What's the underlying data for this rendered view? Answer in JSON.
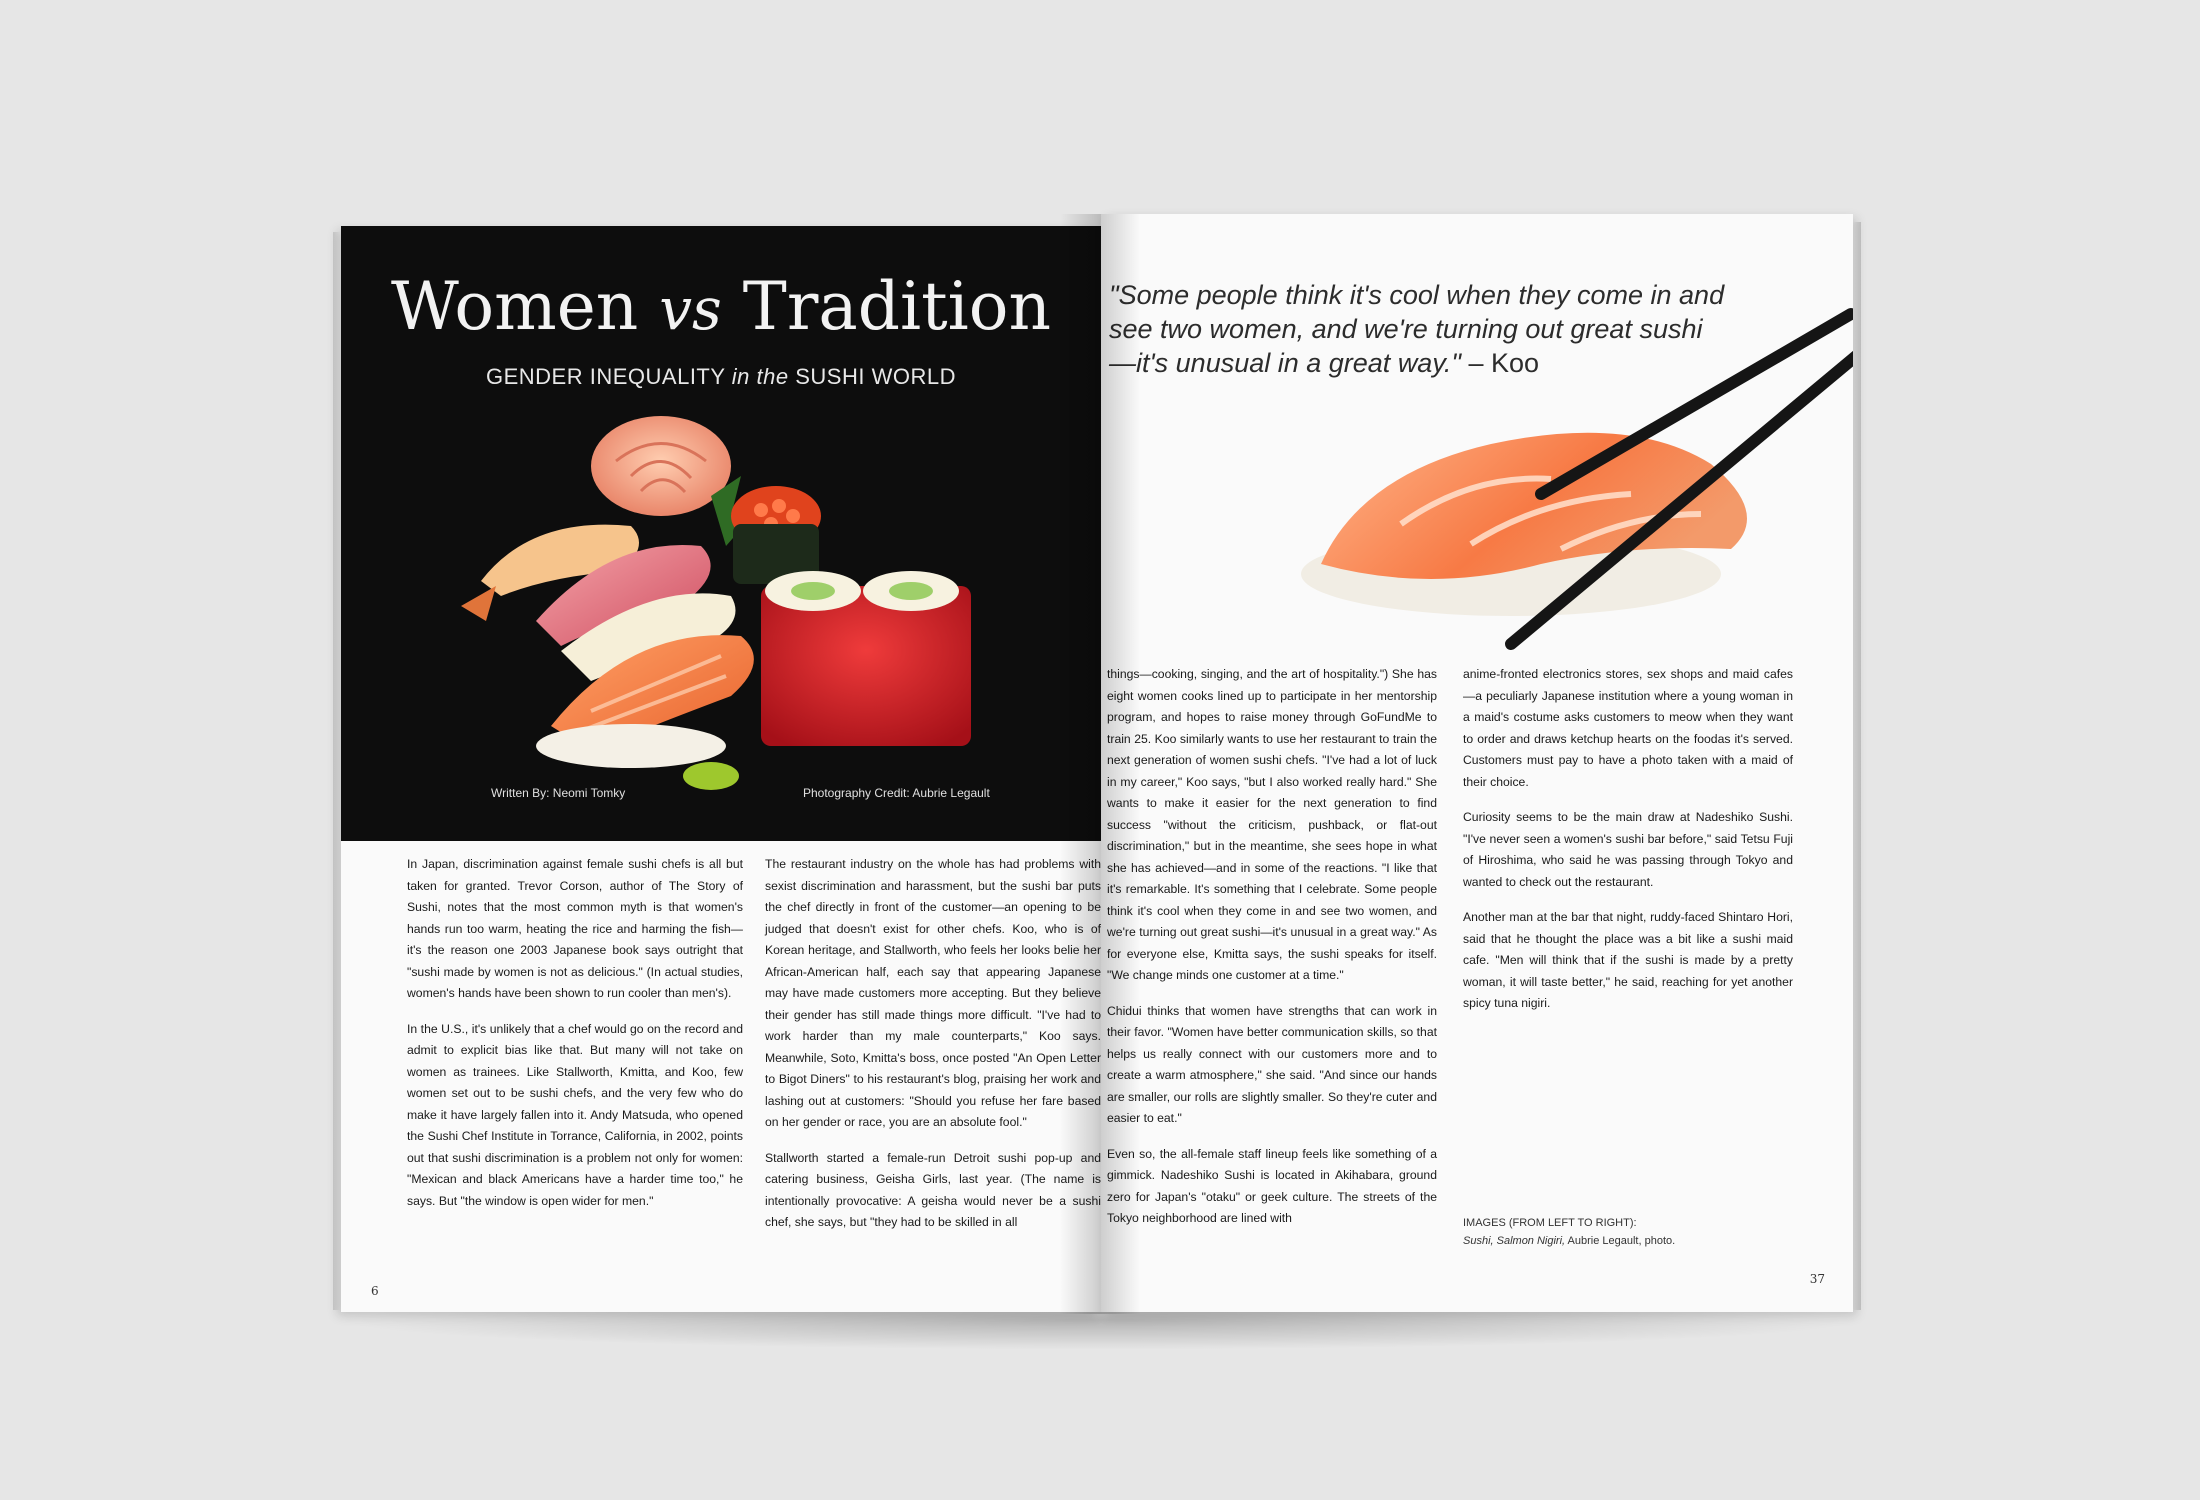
{
  "left_page": {
    "title_main": "Women",
    "title_vs": "vs",
    "title_end": "Tradition",
    "subtitle_a": "GENDER INEQUALITY",
    "subtitle_b": "in the",
    "subtitle_c": "SUSHI WORLD",
    "credit_writer": "Written By: Neomi Tomky",
    "credit_photo": "Photography Credit: Aubrie Legault",
    "col1": [
      "In Japan, discrimination against female sushi chefs is all but taken for granted. Trevor Corson, author of The Story of Sushi, notes that the most common myth is that women's hands run too warm, heating the rice and harming the fish—it's the reason one 2003 Japanese book says outright that \"sushi made by women is not as delicious.\" (In actual studies, women's hands have been shown to run cooler than men's).",
      "In the U.S., it's unlikely that a chef would go on the record and admit to explicit bias like that. But many will not take on women as trainees. Like Stallworth, Kmitta, and Koo, few women set out to be sushi chefs, and the very few who do make it have largely fallen into it. Andy Matsuda, who opened the Sushi Chef Institute in Torrance, California, in 2002, points out that sushi discrimination is a problem not only for women: \"Mexican and black Americans have a harder time too,\" he says. But \"the window is open wider for men.\""
    ],
    "col2": [
      "The restaurant industry on the whole has had problems with sexist discrimination and harassment, but the sushi bar puts the chef directly in front of the customer—an opening to be judged that doesn't exist for other chefs. Koo, who is of Korean heritage, and Stallworth, who feels her looks belie her African-American half, each say that appearing Japanese may have made customers more accepting. But they believe their gender has still made things more difficult. \"I've had to work harder than my male counterparts,\" Koo says. Meanwhile, Soto, Kmitta's boss, once posted \"An Open Letter to Bigot Diners\" to his restaurant's blog, praising her work and lashing out at customers: \"Should you refuse her fare based on her gender or race, you are an absolute fool.\"",
      "Stallworth started a female-run Detroit sushi pop-up and catering business, Geisha Girls, last year. (The name is intentionally provocative: A geisha would never be a sushi chef, she says, but \"they had to be skilled in all"
    ],
    "page_number": "6"
  },
  "right_page": {
    "quote": "\"Some people think it's cool when they come in and see two women, and we're turning out great sushi—it's unusual in a great way.\"",
    "quote_attr": "– Koo",
    "col1": [
      "things—cooking, singing, and the art of hospitality.\") She has eight women cooks lined up to participate in her mentorship program, and hopes to raise money through GoFundMe to train 25. Koo similarly wants to use her restaurant to train the next generation of women sushi chefs. \"I've had a lot of luck in my career,\" Koo says, \"but I also worked really hard.\" She wants to make it easier for the next generation to find success \"without the criticism, pushback, or flat-out discrimination,\" but in the meantime, she sees hope in what she has achieved—and in some of the reactions. \"I like that it's remarkable. It's something that I celebrate. Some people think it's cool when they come in and see two women, and we're turning out great sushi—it's unusual in a great way.\" As for everyone else, Kmitta says, the sushi speaks for itself. \"We change minds one customer at a time.\"",
      "Chidui thinks that women have strengths that can work in their favor. \"Women have better communication skills, so that helps us really connect with our customers more and to create a warm atmosphere,\" she said. \"And since our hands are smaller, our rolls are slightly smaller. So they're cuter and easier to eat.\"",
      "Even so, the all-female staff lineup feels like something of a gimmick. Nadeshiko Sushi is located in Akihabara, ground zero for Japan's \"otaku\" or geek culture. The streets of the Tokyo neighborhood are lined with"
    ],
    "col2": [
      "anime-fronted electronics stores, sex shops and maid cafes—a peculiarly Japanese institution where a young woman in a maid's costume asks customers to meow when they want to order and draws ketchup hearts on the foodas it's served. Customers must pay to have a photo taken with a maid of their choice.",
      "Curiosity seems to be the main draw at Nadeshiko Sushi. \"I've never seen a women's sushi bar before,\" said Tetsu Fuji of Hiroshima, who said he was passing through Tokyo and wanted to check out the restaurant.",
      "Another man at the bar that night, ruddy-faced Shintaro Hori, said that he thought the place was a bit like a sushi maid cafe. \"Men will think that if the sushi is made by a pretty woman, it will taste better,\" he said, reaching for yet another spicy tuna nigiri."
    ],
    "caption_label": "IMAGES (FROM LEFT TO RIGHT):",
    "caption_items": "Sushi, Salmon Nigiri,",
    "caption_credit": "Aubrie Legault, photo.",
    "page_number": "37"
  },
  "colors": {
    "background": "#e6e6e6",
    "page": "#fafafa",
    "hero": "#0d0d0d",
    "salmon": "#f27a45",
    "tobiko": "#d8232a"
  }
}
